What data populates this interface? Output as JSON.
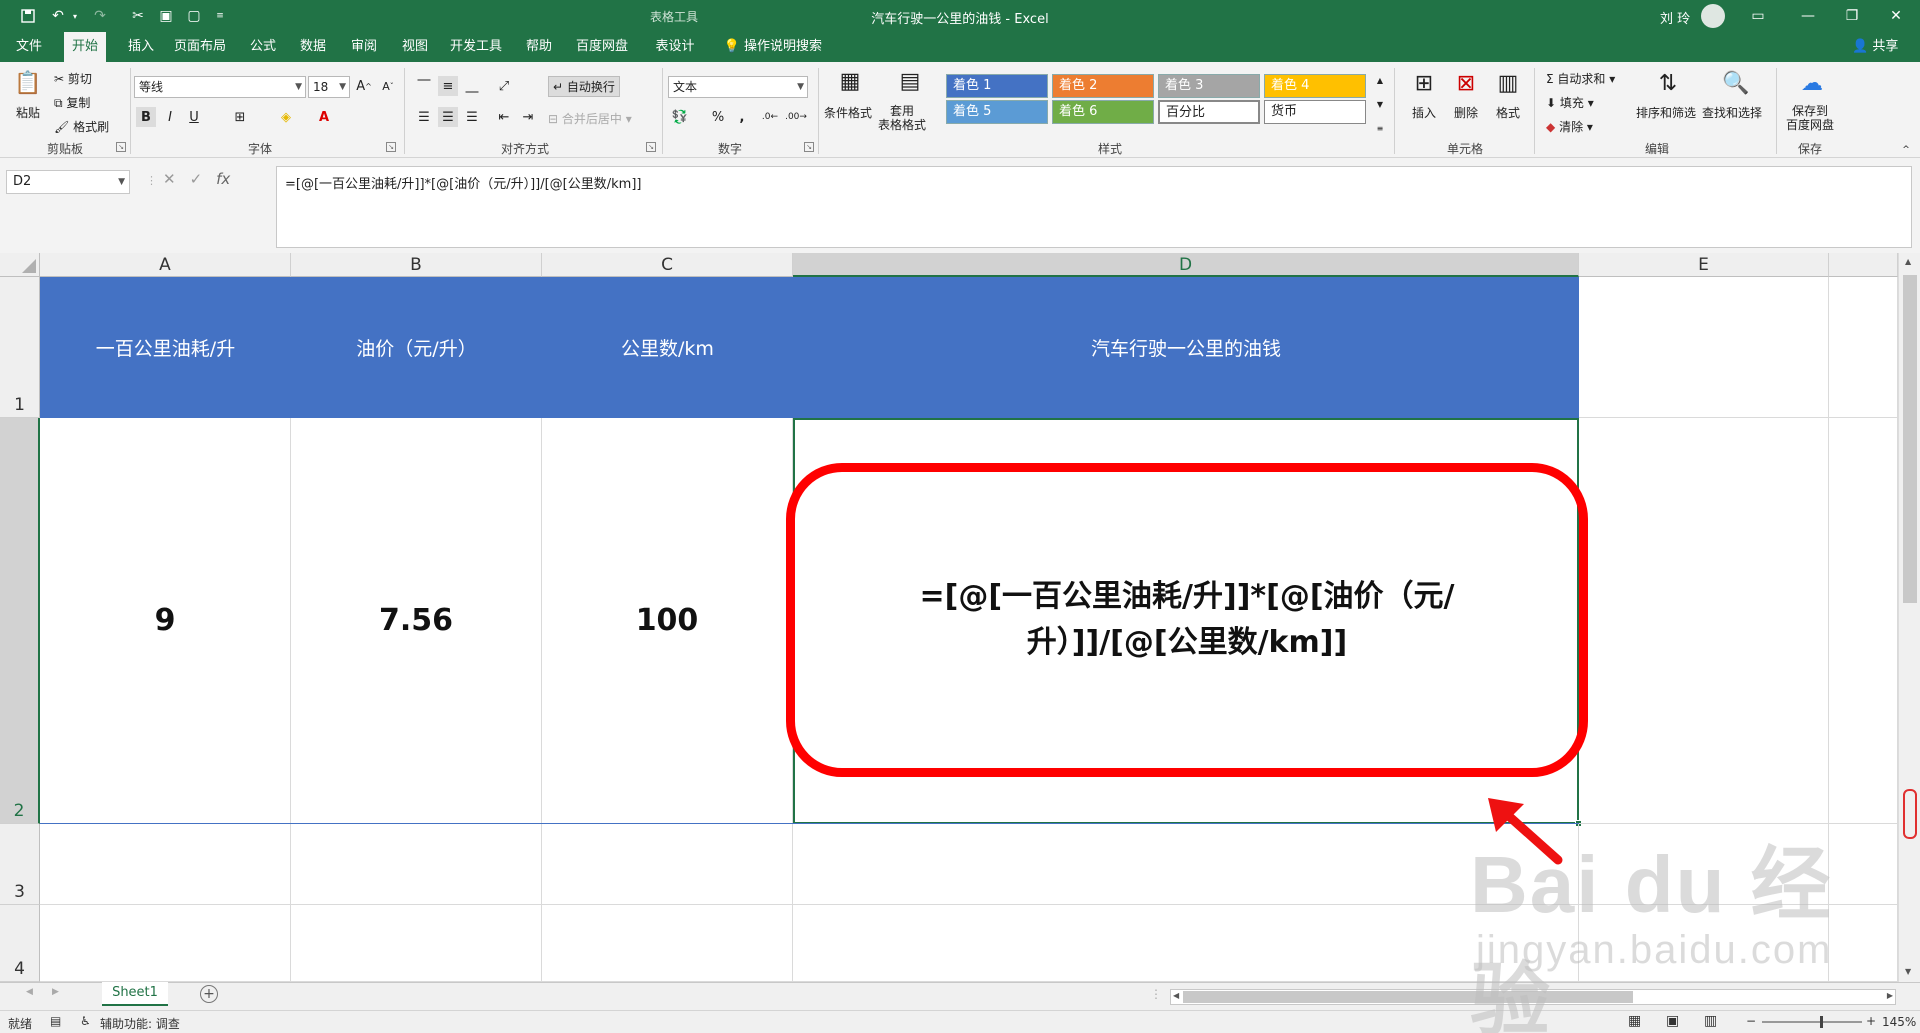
{
  "titlebar": {
    "context_tab": "表格工具",
    "doc_title": "汽车行驶一公里的油钱  -  Excel",
    "user": "刘 玲"
  },
  "tabs": [
    "文件",
    "开始",
    "插入",
    "页面布局",
    "公式",
    "数据",
    "审阅",
    "视图",
    "开发工具",
    "帮助",
    "百度网盘",
    "表设计"
  ],
  "active_tab": "开始",
  "tell_me": "操作说明搜索",
  "share": "共享",
  "ribbon": {
    "clipboard": {
      "paste": "粘贴",
      "cut": "剪切",
      "copy": "复制",
      "format_painter": "格式刷",
      "group": "剪贴板"
    },
    "font": {
      "name": "等线",
      "size": "18",
      "bold": "B",
      "italic": "I",
      "underline": "U",
      "group": "字体"
    },
    "alignment": {
      "wrap": "自动换行",
      "merge": "合并后居中",
      "group": "对齐方式"
    },
    "number": {
      "format": "文本",
      "group": "数字"
    },
    "styles": {
      "cond_format": "条件格式",
      "table_format": "套用\n表格格式",
      "cells": [
        {
          "label": "着色 1",
          "color": "#4472c4"
        },
        {
          "label": "着色 2",
          "color": "#ed7d31"
        },
        {
          "label": "着色 3",
          "color": "#a5a5a5"
        },
        {
          "label": "着色 4",
          "color": "#ffc000"
        },
        {
          "label": "着色 5",
          "color": "#5b9bd5"
        },
        {
          "label": "着色 6",
          "color": "#70ad47"
        },
        {
          "label": "百分比",
          "color": "#ffffff"
        },
        {
          "label": "货币",
          "color": "#ffffff"
        }
      ],
      "group": "样式"
    },
    "cells": {
      "insert": "插入",
      "delete": "删除",
      "format": "格式",
      "group": "单元格"
    },
    "editing": {
      "autosum": "自动求和",
      "fill": "填充",
      "clear": "清除",
      "sort": "排序和筛选",
      "find": "查找和选择",
      "group": "编辑"
    },
    "save": {
      "label": "保存到\n百度网盘",
      "group": "保存"
    }
  },
  "formula_bar": {
    "name_box": "D2",
    "formula": "=[@[一百公里油耗/升]]*[@[油价（元/升）]]/[@[公里数/km]]"
  },
  "columns": [
    "A",
    "B",
    "C",
    "D",
    "E"
  ],
  "rows": [
    "1",
    "2",
    "3",
    "4"
  ],
  "table": {
    "headers": [
      "一百公里油耗/升",
      "油价（元/升）",
      "公里数/km",
      "汽车行驶一公里的油钱"
    ],
    "values": [
      "9",
      "7.56",
      "100"
    ],
    "header_color": "#4472c4"
  },
  "annotation": {
    "text": "=[@[一百公里油耗/升]]*[@[油价（元/升）]]/[@[公里数/km]]",
    "color": "#ff0000"
  },
  "sheets": [
    "Sheet1"
  ],
  "status": {
    "ready": "就绪",
    "accessibility": "辅助功能: 调查",
    "zoom": "145%"
  },
  "watermark": {
    "logo": "Bai du 经验",
    "url": "jingyan.baidu.com"
  }
}
